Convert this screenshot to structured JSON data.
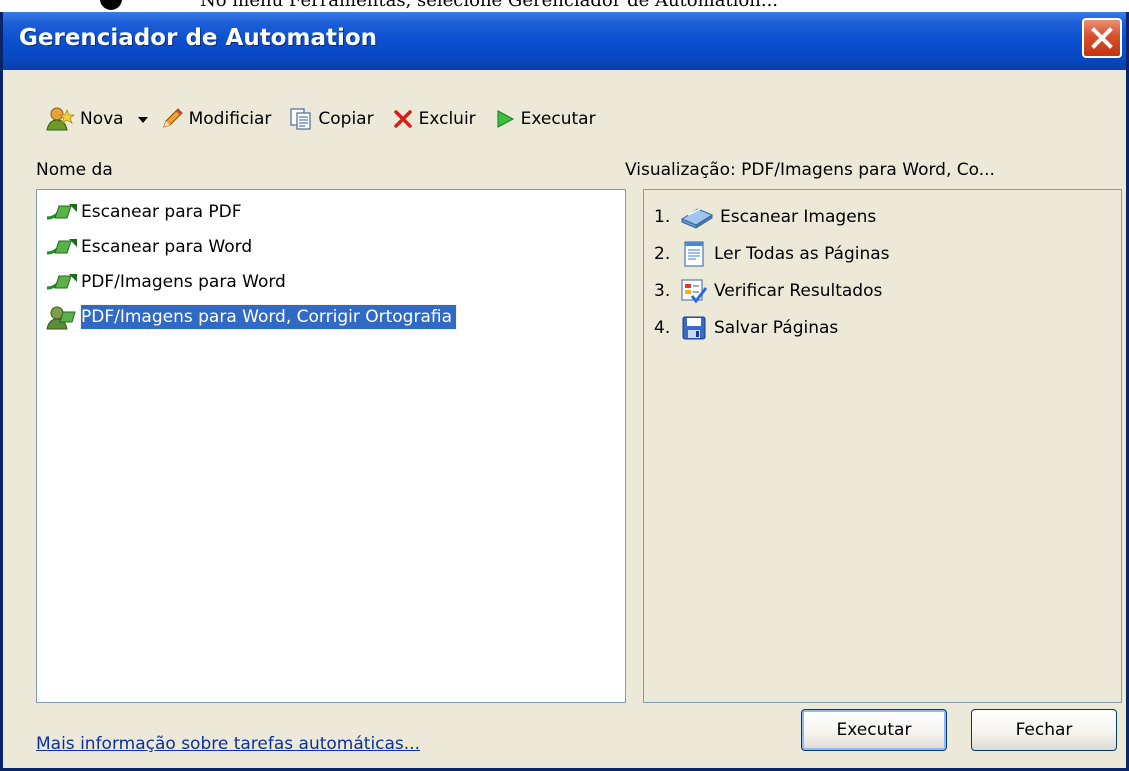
{
  "instruction": {
    "text": "No menu Ferramentas, selecione Gerenciador de Automation..."
  },
  "window": {
    "title": "Gerenciador de Automation"
  },
  "toolbar": {
    "new_label": "Nova",
    "edit_label": "Modificiar",
    "copy_label": "Copiar",
    "delete_label": "Excluir",
    "run_label": "Executar"
  },
  "tasks": {
    "header": "Nome da",
    "items": [
      {
        "label": "Escanear para PDF"
      },
      {
        "label": "Escanear para Word"
      },
      {
        "label": "PDF/Imagens para Word"
      },
      {
        "label": "PDF/Imagens para Word, Corrigir Ortografia",
        "selected": true
      }
    ]
  },
  "preview": {
    "header": "Visualização: PDF/Imagens para Word, Co...",
    "steps": [
      {
        "num": "1.",
        "label": "Escanear Imagens",
        "icon": "scanner-icon"
      },
      {
        "num": "2.",
        "label": "Ler Todas as Páginas",
        "icon": "document-icon"
      },
      {
        "num": "3.",
        "label": "Verificar Resultados",
        "icon": "verify-icon"
      },
      {
        "num": "4.",
        "label": "Salvar Páginas",
        "icon": "floppy-disk-icon"
      }
    ]
  },
  "footer": {
    "link": "Mais informação sobre tarefas automáticas...",
    "execute_label": "Executar",
    "close_label": "Fechar"
  },
  "colors": {
    "titlebar": "#0a4fcf",
    "dialog_bg": "#ece9d8",
    "selection": "#316ac5",
    "link": "#0b2fa8"
  }
}
